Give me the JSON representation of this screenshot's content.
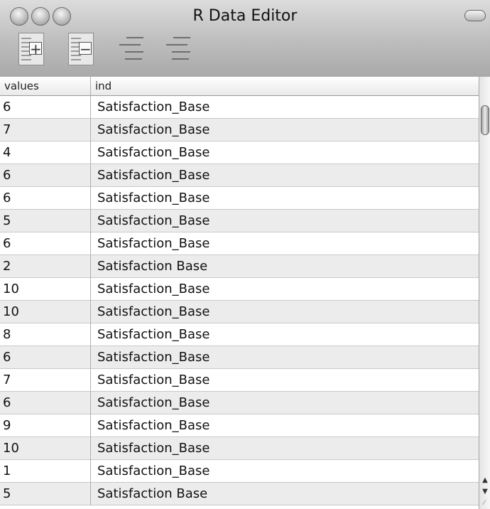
{
  "window": {
    "title": "R Data Editor"
  },
  "table": {
    "columns": [
      "values",
      "ind"
    ],
    "rows": [
      {
        "values": "6",
        "ind": "Satisfaction_Base"
      },
      {
        "values": "7",
        "ind": "Satisfaction_Base"
      },
      {
        "values": "4",
        "ind": "Satisfaction_Base"
      },
      {
        "values": "6",
        "ind": "Satisfaction_Base"
      },
      {
        "values": "6",
        "ind": "Satisfaction_Base"
      },
      {
        "values": "5",
        "ind": "Satisfaction_Base"
      },
      {
        "values": "6",
        "ind": "Satisfaction_Base"
      },
      {
        "values": "2",
        "ind": "Satisfaction Base"
      },
      {
        "values": "10",
        "ind": "Satisfaction_Base"
      },
      {
        "values": "10",
        "ind": "Satisfaction_Base"
      },
      {
        "values": "8",
        "ind": "Satisfaction_Base"
      },
      {
        "values": "6",
        "ind": "Satisfaction_Base"
      },
      {
        "values": "7",
        "ind": "Satisfaction_Base"
      },
      {
        "values": "6",
        "ind": "Satisfaction_Base"
      },
      {
        "values": "9",
        "ind": "Satisfaction_Base"
      },
      {
        "values": "10",
        "ind": "Satisfaction_Base"
      },
      {
        "values": "1",
        "ind": "Satisfaction_Base"
      },
      {
        "values": "5",
        "ind": "Satisfaction Base"
      }
    ]
  },
  "icons": {
    "add_row": "add-row-icon",
    "remove_row": "remove-row-icon",
    "scroll_up": "scroll-up-arrow-icon",
    "scroll_down": "scroll-down-arrow-icon",
    "resize": "resize-grip-icon"
  }
}
